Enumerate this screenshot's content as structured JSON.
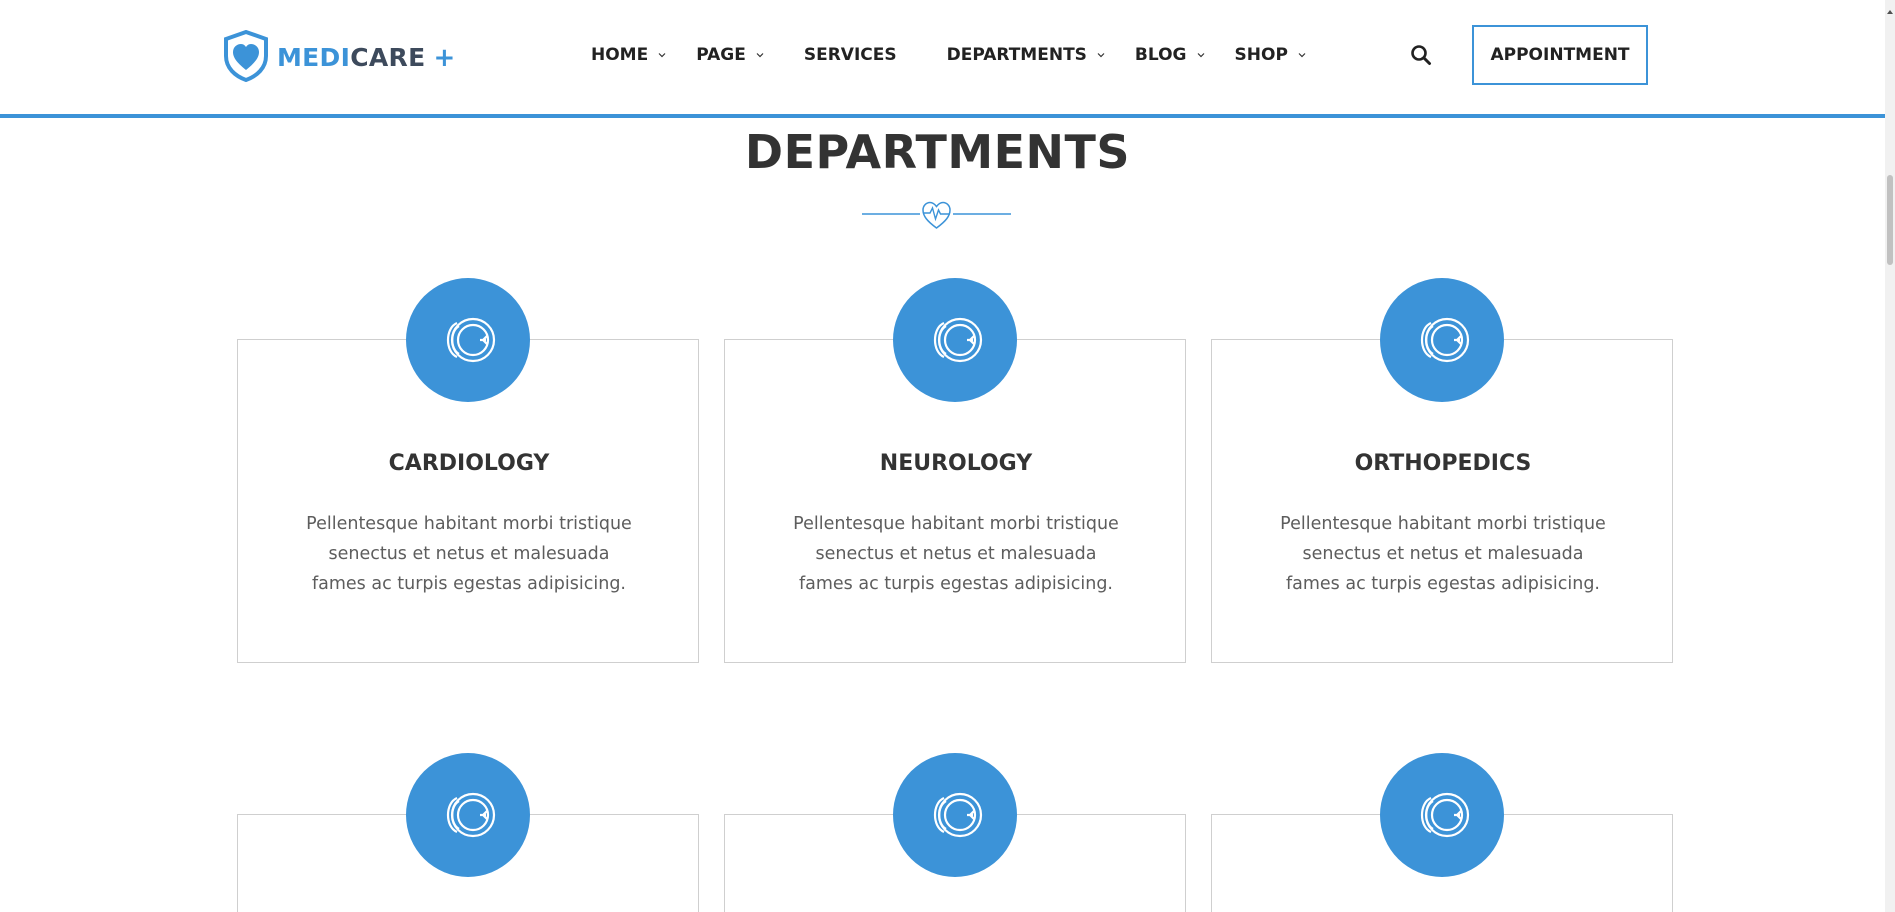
{
  "brand": {
    "logo_part1": "MEDI",
    "logo_part2": "CARE",
    "logo_plus": "+",
    "colors": {
      "accent": "#3c93d8",
      "text_dark": "#333333",
      "logo_dark": "#3d4a5c"
    },
    "logo_icon": "shield-heart-icon"
  },
  "nav": {
    "items": [
      {
        "label": "HOME",
        "has_dropdown": true
      },
      {
        "label": "PAGE",
        "has_dropdown": true
      },
      {
        "label": "SERVICES",
        "has_dropdown": false
      },
      {
        "label": "DEPARTMENTS",
        "has_dropdown": true
      },
      {
        "label": "BLOG",
        "has_dropdown": true
      },
      {
        "label": "SHOP",
        "has_dropdown": true
      }
    ],
    "search_icon": "search-icon",
    "appointment_label": "APPOINTMENT"
  },
  "section": {
    "title": "DEPARTMENTS",
    "divider_icon": "heartbeat-icon"
  },
  "departments": [
    {
      "name": "CARDIOLOGY",
      "icon": "eye-lens-icon",
      "description_lines": [
        "Pellentesque habitant morbi tristique",
        "senectus et netus et malesuada",
        "fames ac turpis egestas adipisicing."
      ]
    },
    {
      "name": "NEUROLOGY",
      "icon": "eye-lens-icon",
      "description_lines": [
        "Pellentesque habitant morbi tristique",
        "senectus et netus et malesuada",
        "fames ac turpis egestas adipisicing."
      ]
    },
    {
      "name": "ORTHOPEDICS",
      "icon": "eye-lens-icon",
      "description_lines": [
        "Pellentesque habitant morbi tristique",
        "senectus et netus et malesuada",
        "fames ac turpis egestas adipisicing."
      ]
    },
    {
      "name": "",
      "icon": "eye-lens-icon",
      "description_lines": []
    },
    {
      "name": "",
      "icon": "eye-lens-icon",
      "description_lines": []
    },
    {
      "name": "",
      "icon": "eye-lens-icon",
      "description_lines": []
    }
  ]
}
